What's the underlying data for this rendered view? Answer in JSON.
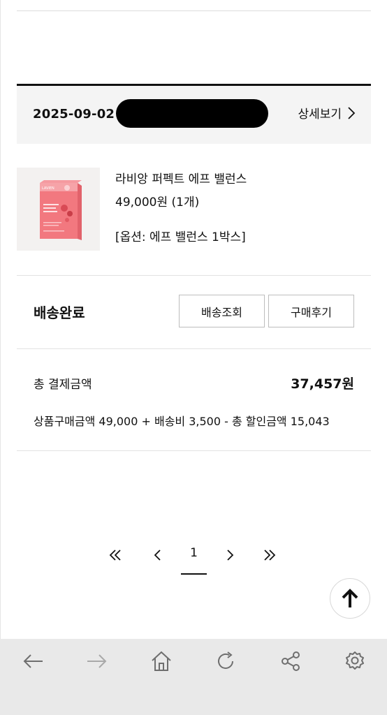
{
  "order": {
    "date": "2025-09-02",
    "detail_link": "상세보기"
  },
  "product": {
    "name": "라비앙 퍼펙트 에프 밸런스",
    "price": "49,000원 (1개)",
    "option": "[옵션: 에프 밸런스 1박스]",
    "thumb_brand": "LAVIEN"
  },
  "status": {
    "label": "배송완료",
    "track_button": "배송조회",
    "review_button": "구매후기"
  },
  "payment": {
    "total_label": "총 결제금액",
    "total_value": "37,457원",
    "breakdown": "상품구매금액 49,000 + 배송비 3,500 - 총 할인금액 15,043"
  },
  "pagination": {
    "current_page": "1"
  },
  "browser_bar": {
    "icons": [
      "back-icon",
      "forward-icon",
      "home-icon",
      "refresh-icon",
      "share-icon",
      "settings-icon"
    ]
  },
  "colors": {
    "product_pink": "#f0707a",
    "header_bg": "#f4f4f4",
    "browser_bar_bg": "#e9e9e9",
    "disabled_icon": "#a9a9a9"
  }
}
